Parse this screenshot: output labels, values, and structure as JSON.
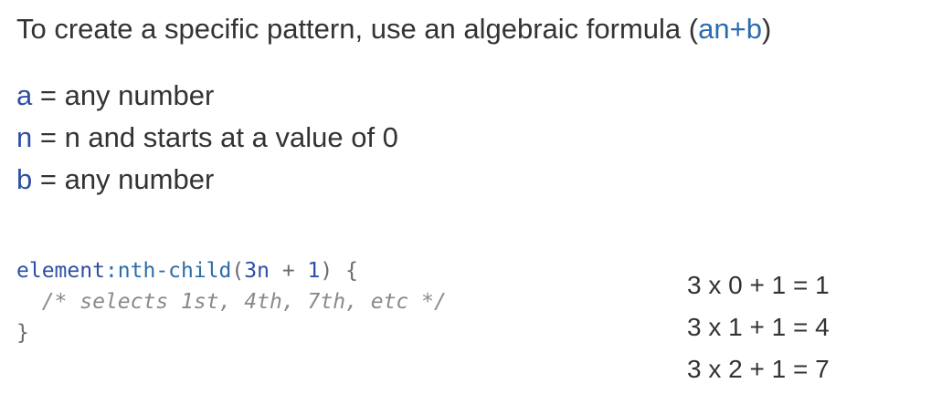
{
  "heading": {
    "text": "To create a specific pattern, use an algebraic formula (",
    "formula": "an+b",
    "close": ")"
  },
  "definitions": [
    {
      "var": "a",
      "rest": " = any number"
    },
    {
      "var": "n",
      "rest": " = n and starts at a value of 0"
    },
    {
      "var": "b",
      "rest": " = any number"
    }
  ],
  "code": {
    "selector": "element",
    "pseudo": ":nth-child",
    "open_paren": "(",
    "arg_n": "3n",
    "arg_plus": " + ",
    "arg_b": "1",
    "close_paren": ")",
    "open_brace": " {",
    "comment": "/* selects 1st, 4th, 7th, etc */",
    "close_brace": "}"
  },
  "calculations": [
    "3 x 0 + 1 = 1",
    "3 x 1 + 1 = 4",
    "3 x 2 + 1 = 7"
  ]
}
